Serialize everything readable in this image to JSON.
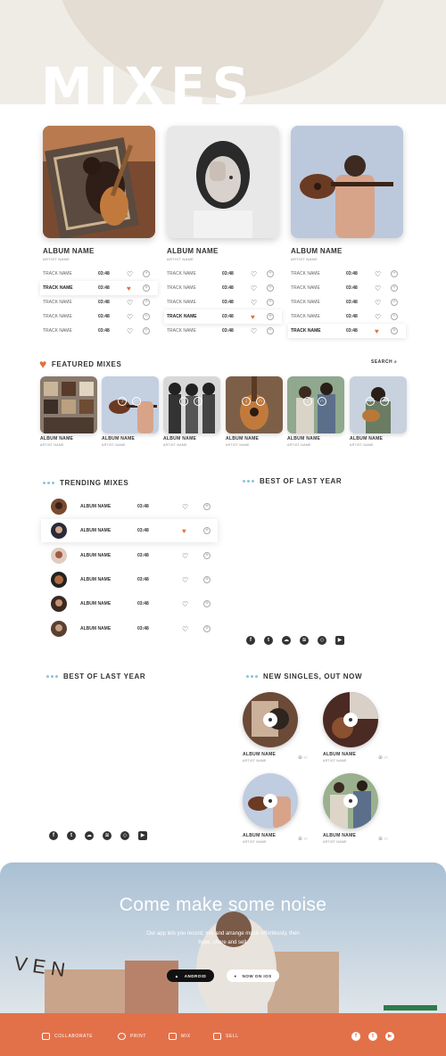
{
  "hero": {
    "title": "MIXES"
  },
  "albums": [
    {
      "name": "ALBUM NAME",
      "artist": "ARTIST NAME",
      "tracks": [
        {
          "name": "TRACK NAME",
          "duration": "03:48",
          "liked": false
        },
        {
          "name": "TRACK NAME",
          "duration": "03:48",
          "liked": true
        },
        {
          "name": "TRACK NAME",
          "duration": "03:48",
          "liked": false
        },
        {
          "name": "TRACK NAME",
          "duration": "03:48",
          "liked": false
        },
        {
          "name": "TRACK NAME",
          "duration": "03:48",
          "liked": false
        }
      ]
    },
    {
      "name": "ALBUM NAME",
      "artist": "ARTIST NAME",
      "tracks": [
        {
          "name": "TRACK NAME",
          "duration": "03:48",
          "liked": false
        },
        {
          "name": "TRACK NAME",
          "duration": "03:48",
          "liked": false
        },
        {
          "name": "TRACK NAME",
          "duration": "03:48",
          "liked": false
        },
        {
          "name": "TRACK NAME",
          "duration": "03:48",
          "liked": true
        },
        {
          "name": "TRACK NAME",
          "duration": "03:48",
          "liked": false
        }
      ]
    },
    {
      "name": "ALBUM NAME",
      "artist": "ARTIST NAME",
      "tracks": [
        {
          "name": "TRACK NAME",
          "duration": "03:48",
          "liked": false
        },
        {
          "name": "TRACK NAME",
          "duration": "03:48",
          "liked": false
        },
        {
          "name": "TRACK NAME",
          "duration": "03:48",
          "liked": false
        },
        {
          "name": "TRACK NAME",
          "duration": "03:48",
          "liked": false
        },
        {
          "name": "TRACK NAME",
          "duration": "03:48",
          "liked": true
        }
      ]
    }
  ],
  "featured": {
    "title": "FEATURED MIXES",
    "search_label": "SEARCH",
    "items": [
      {
        "name": "ALBUM NAME",
        "artist": "ARTIST NAME"
      },
      {
        "name": "ALBUM NAME",
        "artist": "ARTIST NAME"
      },
      {
        "name": "ALBUM NAME",
        "artist": "ARTIST NAME"
      },
      {
        "name": "ALBUM NAME",
        "artist": "ARTIST NAME"
      },
      {
        "name": "ALBUM NAME",
        "artist": "ARTIST NAME"
      },
      {
        "name": "ALBUM NAME",
        "artist": "ARTIST NAME"
      }
    ]
  },
  "trending": {
    "title": "TRENDING MIXES",
    "rows": [
      {
        "name": "ALBUM NAME",
        "duration": "03:48",
        "liked": false
      },
      {
        "name": "ALBUM NAME",
        "duration": "03:48",
        "liked": true
      },
      {
        "name": "ALBUM NAME",
        "duration": "03:48",
        "liked": false
      },
      {
        "name": "ALBUM NAME",
        "duration": "03:48",
        "liked": false
      },
      {
        "name": "ALBUM NAME",
        "duration": "03:48",
        "liked": false
      },
      {
        "name": "ALBUM NAME",
        "duration": "03:48",
        "liked": false
      }
    ]
  },
  "best_last_year_right": {
    "title": "BEST OF LAST YEAR"
  },
  "best_last_year_left": {
    "title": "BEST OF LAST YEAR"
  },
  "new_singles": {
    "title": "NEW SINGLES, OUT NOW",
    "items": [
      {
        "name": "ALBUM NAME",
        "artist": "ARTIST NAME"
      },
      {
        "name": "ALBUM NAME",
        "artist": "ARTIST NAME"
      },
      {
        "name": "ALBUM NAME",
        "artist": "ARTIST NAME"
      },
      {
        "name": "ALBUM NAME",
        "artist": "ARTIST NAME"
      }
    ]
  },
  "social_icons": [
    "facebook-icon",
    "twitter-icon",
    "soundcloud-icon",
    "spotify-icon",
    "compass-icon",
    "youtube-icon"
  ],
  "banner": {
    "title": "Come make some noise",
    "text": "Our app lets you record, mix and arrange music effortlessly, then hype, share and sell.",
    "android_label": "ANDROID",
    "ios_label": "NOW ON IOS"
  },
  "footer": {
    "items": [
      "COLLABORATE",
      "PRINT",
      "MIX",
      "SELL"
    ],
    "social_icons": [
      "facebook-icon",
      "twitter-icon",
      "youtube-icon"
    ]
  },
  "colors": {
    "accent": "#e2714a",
    "heart": "#e0703f",
    "dots": "#8ec3d8",
    "hero_bg": "#efece6"
  }
}
